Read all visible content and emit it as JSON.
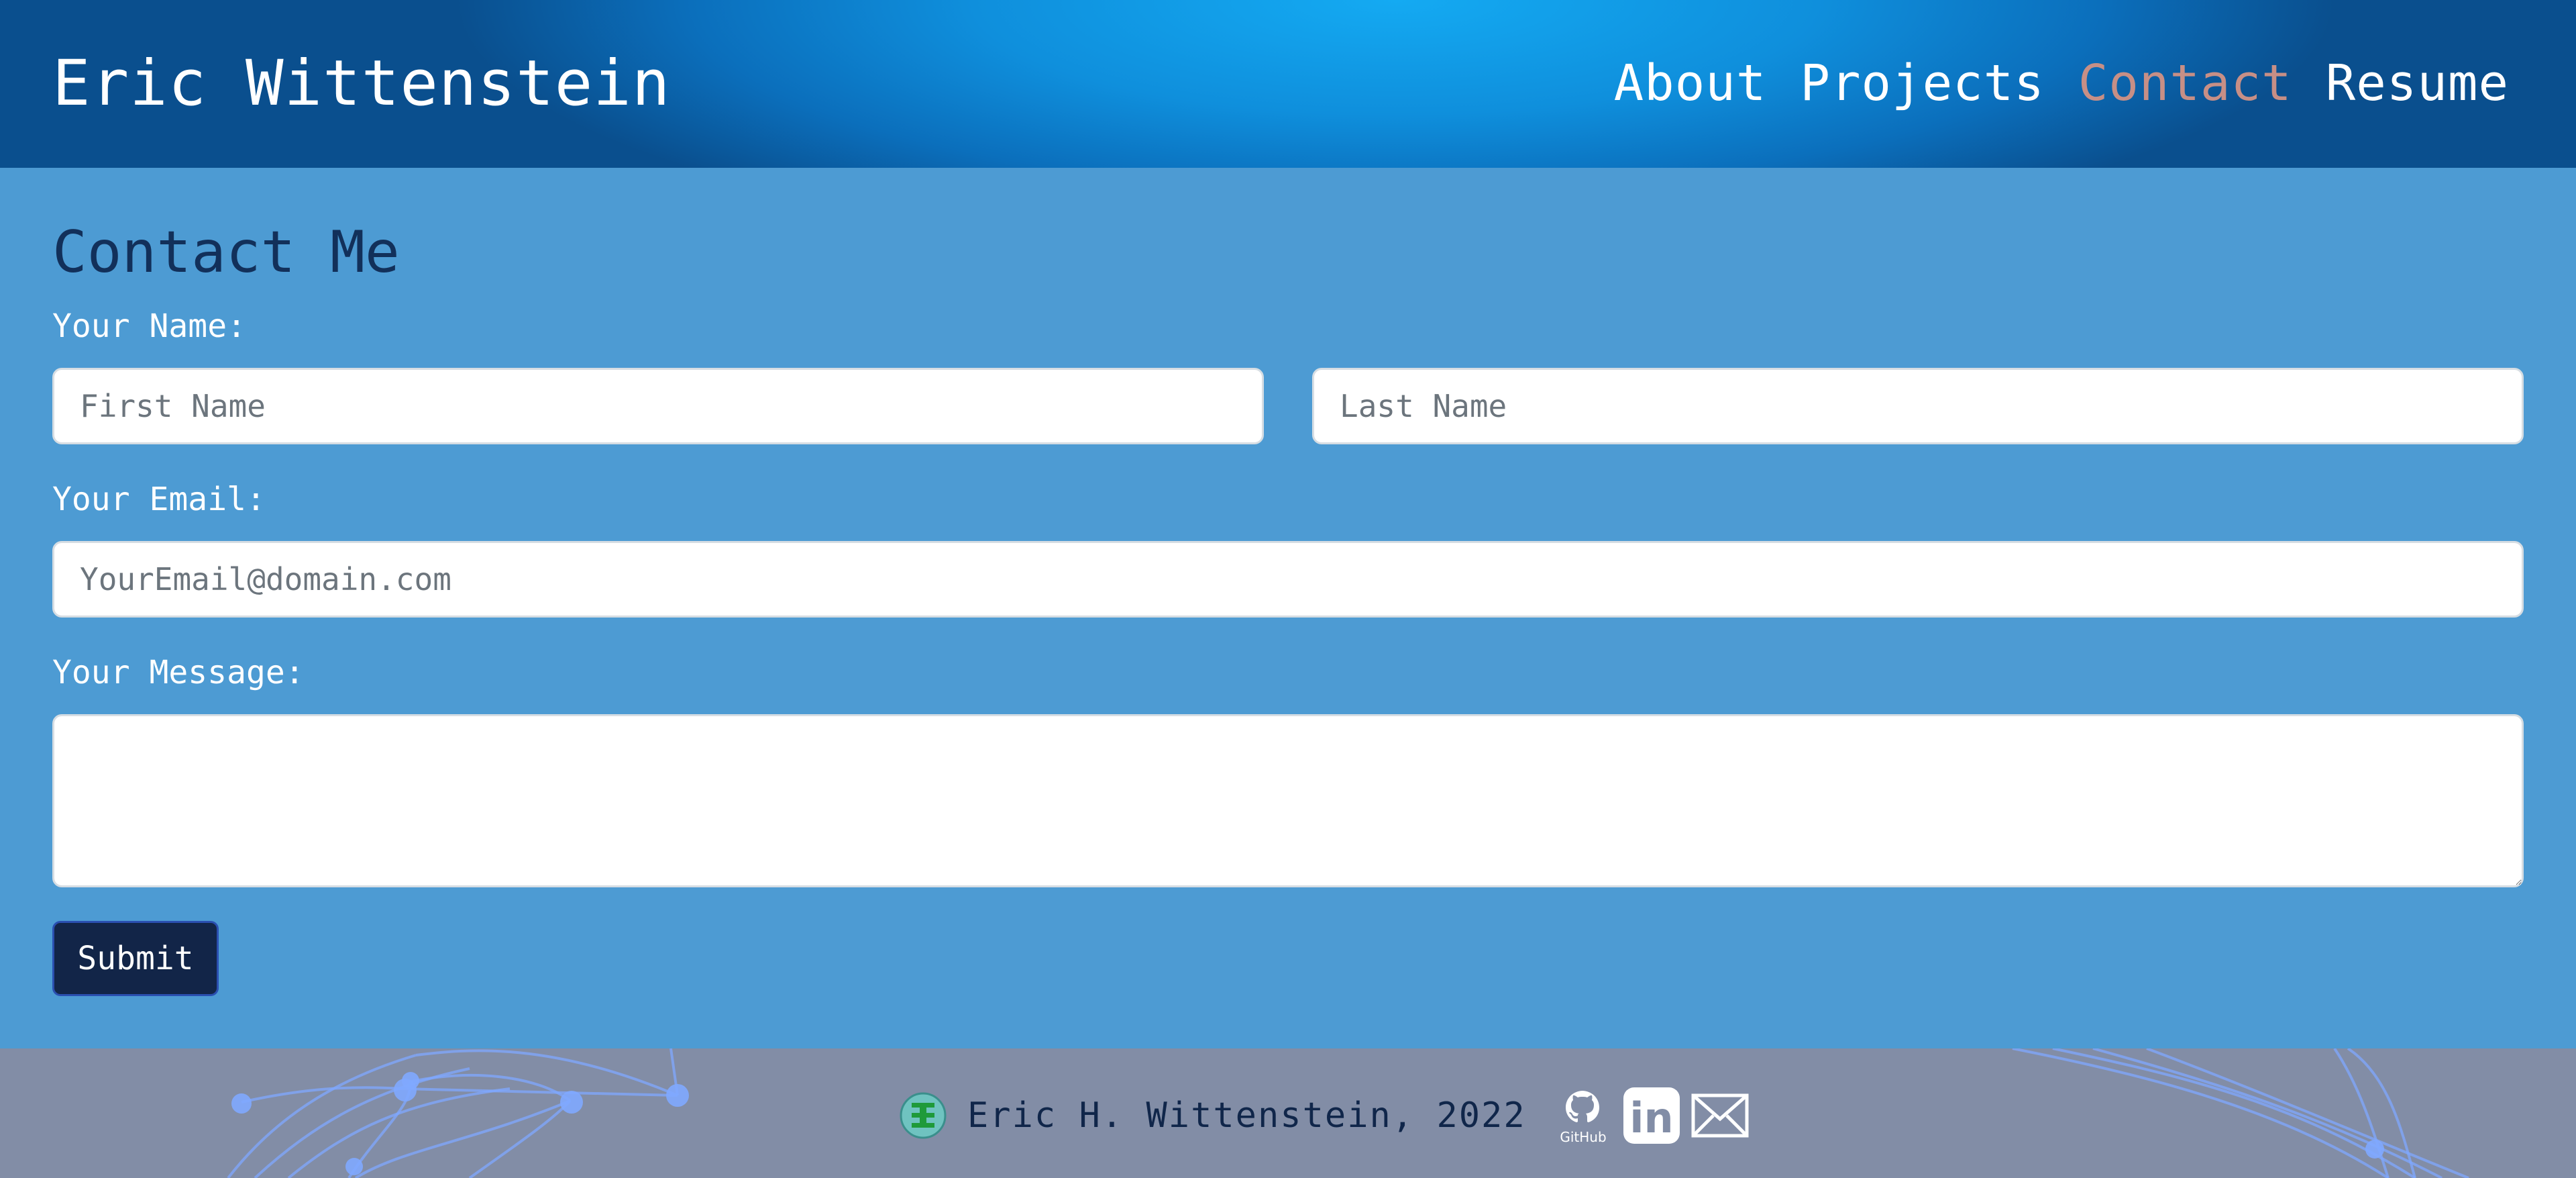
{
  "header": {
    "brand": "Eric Wittenstein",
    "nav": [
      {
        "label": "About",
        "active": false
      },
      {
        "label": "Projects",
        "active": false
      },
      {
        "label": "Contact",
        "active": true
      },
      {
        "label": "Resume",
        "active": false
      }
    ]
  },
  "form": {
    "title": "Contact Me",
    "name_label": "Your Name:",
    "first_name_placeholder": "First Name",
    "last_name_placeholder": "Last Name",
    "email_label": "Your Email:",
    "email_placeholder": "YourEmail@domain.com",
    "message_label": "Your Message:",
    "submit_label": "Submit"
  },
  "footer": {
    "copyright": "Eric H. Wittenstein, 2022",
    "logo_letter": "E",
    "social": [
      {
        "icon": "github-icon",
        "text": "GitHub"
      },
      {
        "icon": "linkedin-icon",
        "text": "in"
      },
      {
        "icon": "email-icon"
      }
    ]
  },
  "colors": {
    "header_accent": "#14aaf2",
    "main_bg": "#4d9bd3",
    "active_nav": "#c78f86",
    "button_bg": "#122548",
    "footer_bg": "#828da6"
  }
}
